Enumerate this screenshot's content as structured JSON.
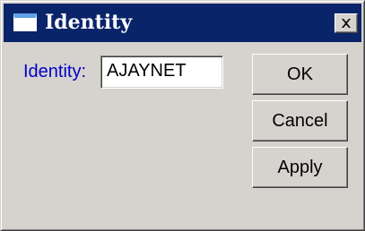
{
  "window": {
    "title": "Identity",
    "close_label": "close"
  },
  "form": {
    "identity_label": "Identity:",
    "identity_value": "AJAYNET"
  },
  "buttons": {
    "ok_label": "OK",
    "cancel_label": "Cancel",
    "apply_label": "Apply"
  },
  "colors": {
    "titlebar": "#0a246a",
    "label_text": "#0000cc",
    "window_face": "#d6d3ce"
  },
  "icons": {
    "window_icon": "window-icon",
    "close_icon": "close-icon"
  }
}
